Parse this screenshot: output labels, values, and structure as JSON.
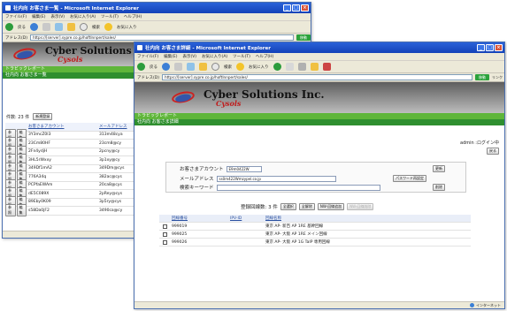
{
  "back_window": {
    "title": "社内向 お客さま一覧 - Microsoft Internet Explorer",
    "menu": [
      "ファイル(F)",
      "編集(E)",
      "表示(V)",
      "お気に入り(A)",
      "ツール(T)",
      "ヘルプ(H)"
    ],
    "toolbar": {
      "back": "戻る",
      "search": "検索",
      "favorites": "お気に入り"
    },
    "address_label": "アドレス(D)",
    "address": "https://[server].sypre.co.jp/hoftInnpert/sales/",
    "go": "移動",
    "brand_name": "Cyber Solutions Inc",
    "brand_sub": "Cysols",
    "nav": "トラビックレポート",
    "sub": "社内向 お客さま一覧",
    "count_label": "件数: 23 件",
    "new_button": "新規登録",
    "table": {
      "headers": [
        "お客さまアカウント",
        "メールアドレス"
      ],
      "rows": [
        [
          "3Y3mcZ0I3",
          "313m48cya"
        ],
        [
          "23Cm80HF",
          "23cm8@cy"
        ],
        [
          "2Fn4ydjH",
          "2pcny@cy"
        ],
        [
          "3HL5rWxxy",
          "3p1xy@cy"
        ],
        [
          "349Df1mA2",
          "349Dm@cys"
        ],
        [
          "776A34q",
          "382ac@cys"
        ],
        [
          "PCPfaEWAm",
          "20ca8@cys"
        ],
        [
          "dE5C089X",
          "2pRey@cys"
        ],
        [
          "89Eby0K09",
          "3p5ry@cys"
        ],
        [
          "s58Da0jF2",
          "3490ca@cy"
        ]
      ],
      "row_buttons": [
        "参照",
        "編集"
      ]
    }
  },
  "front_window": {
    "title": "社内向 お客さま詳細 - Microsoft Internet Explorer",
    "menu": [
      "ファイル(F)",
      "編集(E)",
      "表示(V)",
      "お気に入り(A)",
      "ツール(T)",
      "ヘルプ(H)"
    ],
    "toolbar": {
      "back": "戻る",
      "search": "検索",
      "favorites": "お気に入り"
    },
    "address_label": "アドレス(D)",
    "address": "https://[server].sypre.co.jp/hoftInnpert/sales/",
    "go": "移動",
    "links": "リンク",
    "brand_name": "Cyber Solutions Inc.",
    "brand_sub": "Cysols",
    "nav": "トラビックレポート",
    "sub": "社内向 お客さま詳細",
    "user": "admin :ログイン中",
    "back_button": "戻る",
    "form": {
      "account_label": "お客さまアカウント",
      "account_value": "E9m0422W",
      "change_button": "更新",
      "email_label": "メールアドレス",
      "email_value": "ss0m422Wmzypel.co.jp",
      "password_button": "パスワード再設定",
      "keyword_label": "検索キーワード",
      "keyword_value": "",
      "delete_button": "削除"
    },
    "lines": {
      "count_label": "登録回線数: 3 件",
      "select_all": "全選択",
      "clear_all": "全解除",
      "add_button": "NW-回線追加",
      "remove_button": "NW-回線削除"
    },
    "table": {
      "headers": [
        "回線番号",
        "IPV-ID",
        "回線名称"
      ],
      "rows": [
        [
          "999019",
          "",
          "東京 AP- 新百 AP 1RE 基幹回線"
        ],
        [
          "999025",
          "",
          "東京 AP- 大阪 AP 1RE メイン回線"
        ],
        [
          "999026",
          "",
          "東京 AP- 大阪 AP 1G TaIP 専用回線"
        ]
      ]
    },
    "status_zone": "インターネット"
  }
}
